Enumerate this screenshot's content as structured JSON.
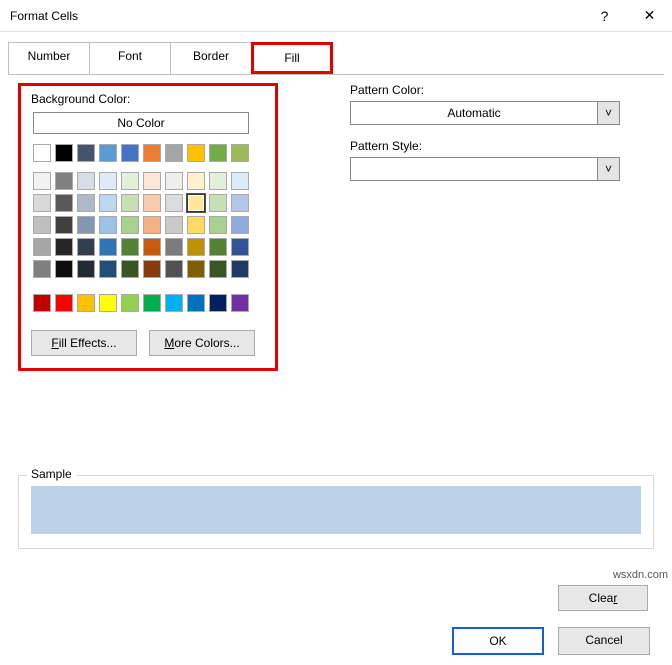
{
  "window": {
    "title": "Format Cells",
    "help_icon": "?",
    "close_icon": "✕"
  },
  "tabs": {
    "items": [
      "Number",
      "Font",
      "Border",
      "Fill"
    ],
    "active": "Fill"
  },
  "left": {
    "label": "Background Color:",
    "no_color": "No Color",
    "fill_effects": "Fill Effects...",
    "more_colors": "More Colors...",
    "theme_row": [
      "#ffffff",
      "#000000",
      "#44546a",
      "#5b9bd5",
      "#4472c4",
      "#ed7d31",
      "#a5a5a5",
      "#ffc000",
      "#70ad47",
      "#9bbb59"
    ],
    "theme_tints": [
      [
        "#f2f2f2",
        "#808080",
        "#d6dce5",
        "#deebf7",
        "#e2efda",
        "#fce4d6",
        "#ededed",
        "#fff2cc",
        "#e2f0d9",
        "#ddebf7"
      ],
      [
        "#d9d9d9",
        "#595959",
        "#adb9ca",
        "#bdd7ee",
        "#c6e0b4",
        "#f8cbad",
        "#dbdbdb",
        "#ffe699",
        "#c5e0b4",
        "#b4c7e7"
      ],
      [
        "#bfbfbf",
        "#404040",
        "#8497b0",
        "#9cc3e6",
        "#a9d18e",
        "#f4b183",
        "#c9c9c9",
        "#ffd966",
        "#a9d08e",
        "#8faadc"
      ],
      [
        "#a6a6a6",
        "#262626",
        "#333f50",
        "#2e75b6",
        "#548235",
        "#c55a11",
        "#7b7b7b",
        "#bf9000",
        "#548235",
        "#2f5597"
      ],
      [
        "#7f7f7f",
        "#0d0d0d",
        "#222a35",
        "#1f4e79",
        "#375623",
        "#843c0c",
        "#525252",
        "#7f6000",
        "#385724",
        "#203864"
      ]
    ],
    "selected": [
      1,
      7
    ],
    "standard": [
      "#c00000",
      "#ff0000",
      "#ffc000",
      "#ffff00",
      "#92d050",
      "#00b050",
      "#00b0f0",
      "#0070c0",
      "#002060",
      "#7030a0"
    ]
  },
  "right": {
    "pattern_color_label": "Pattern Color:",
    "pattern_color_value": "Automatic",
    "pattern_style_label": "Pattern Style:",
    "pattern_style_value": ""
  },
  "sample": {
    "label": "Sample",
    "color": "#bcd2e8"
  },
  "buttons": {
    "clear": "Clear",
    "ok": "OK",
    "cancel": "Cancel"
  },
  "watermark": "wsxdn.com"
}
